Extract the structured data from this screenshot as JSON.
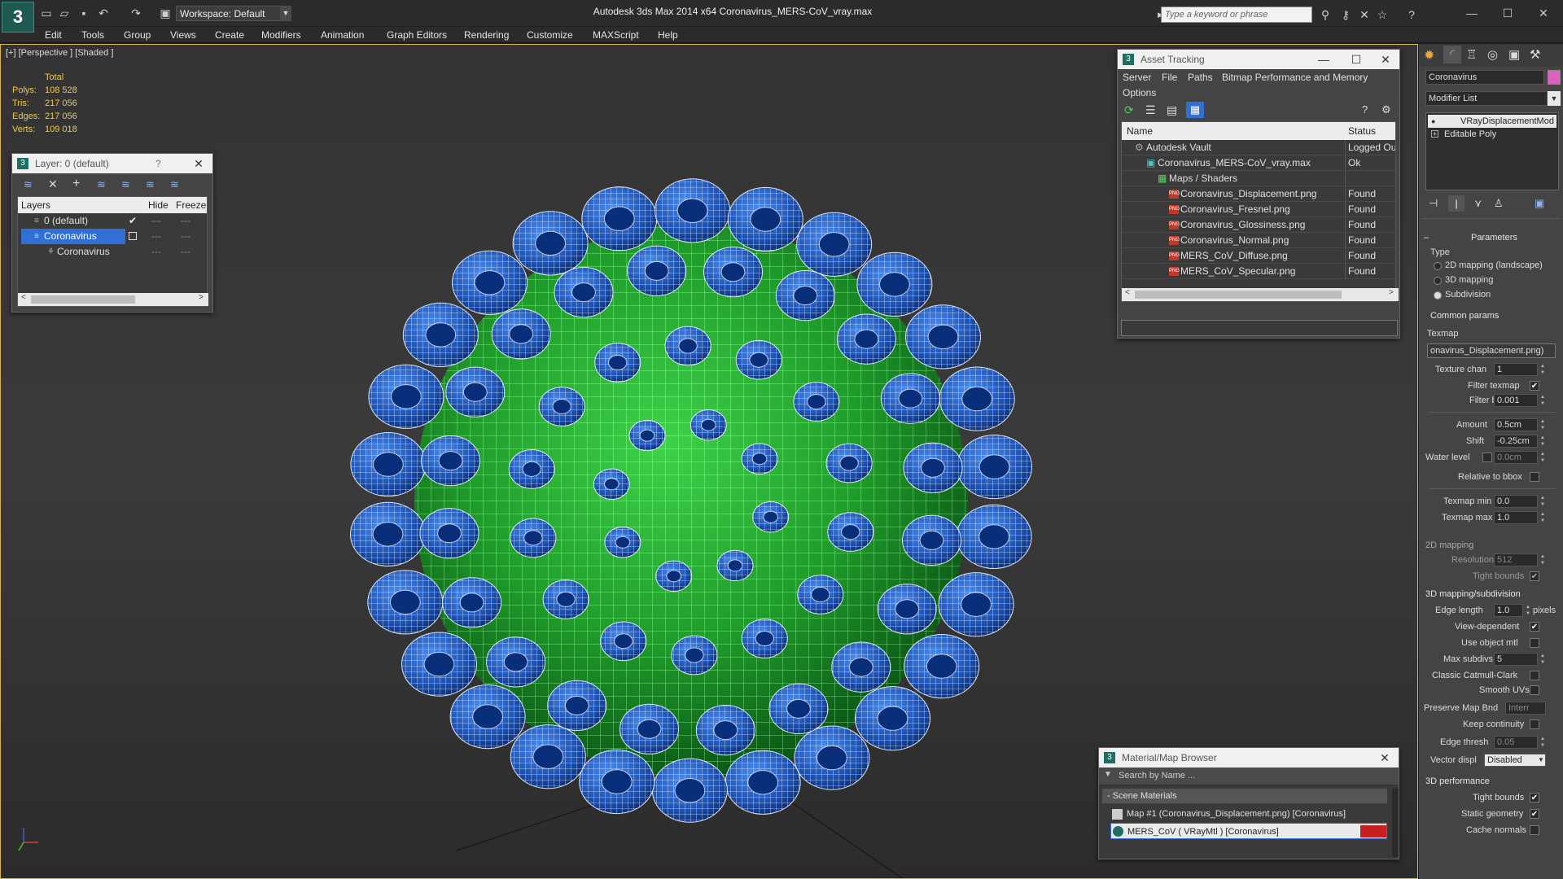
{
  "titlebar": {
    "workspace": "Workspace: Default",
    "title": "Autodesk 3ds Max  2014 x64      Coronavirus_MERS-CoV_vray.max",
    "search_placeholder": "Type a keyword or phrase"
  },
  "menu": [
    "Edit",
    "Tools",
    "Group",
    "Views",
    "Create",
    "Modifiers",
    "Animation",
    "Graph Editors",
    "Rendering",
    "Customize",
    "MAXScript",
    "Help"
  ],
  "viewport": {
    "label": "[+] [Perspective ] [Shaded ]",
    "stats_header": "Total",
    "stats": [
      {
        "key": "Polys:",
        "value": "108 528"
      },
      {
        "key": "Tris:",
        "value": "217 056"
      },
      {
        "key": "Edges:",
        "value": "217 056"
      },
      {
        "key": "Verts:",
        "value": "109 018"
      }
    ]
  },
  "layer_window": {
    "title": "Layer: 0 (default)",
    "help": "?",
    "columns": [
      "Layers",
      "Hide",
      "Freeze"
    ],
    "rows": [
      "0 (default)",
      "Coronavirus",
      "Coronavirus"
    ]
  },
  "asset_tracking": {
    "title": "Asset Tracking",
    "menu": [
      "Server",
      "File",
      "Paths",
      "Bitmap Performance and Memory",
      "Options"
    ],
    "columns": [
      "Name",
      "Status"
    ],
    "rows": [
      {
        "name": "Autodesk Vault",
        "status": "Logged Ou"
      },
      {
        "name": "Coronavirus_MERS-CoV_vray.max",
        "status": "Ok"
      },
      {
        "name": "Maps / Shaders",
        "status": ""
      },
      {
        "name": "Coronavirus_Displacement.png",
        "status": "Found"
      },
      {
        "name": "Coronavirus_Fresnel.png",
        "status": "Found"
      },
      {
        "name": "Coronavirus_Glossiness.png",
        "status": "Found"
      },
      {
        "name": "Coronavirus_Normal.png",
        "status": "Found"
      },
      {
        "name": "MERS_CoV_Diffuse.png",
        "status": "Found"
      },
      {
        "name": "MERS_CoV_Specular.png",
        "status": "Found"
      }
    ]
  },
  "material_browser": {
    "title": "Material/Map Browser",
    "search_placeholder": "Search by Name ...",
    "section": "- Scene Materials",
    "items": [
      "Map #1 (Coronavirus_Displacement.png) [Coronavirus]",
      "MERS_CoV  ( VRayMtl )  [Coronavirus]"
    ]
  },
  "command_panel": {
    "object_name": "Coronavirus",
    "modifier_list": "Modifier List",
    "stack": [
      "VRayDisplacementMod",
      "Editable Poly"
    ],
    "rollout": "Parameters",
    "type_label": "Type",
    "type_options": [
      "2D mapping (landscape)",
      "3D mapping",
      "Subdivision"
    ],
    "common_params": "Common params",
    "texmap_label": "Texmap",
    "texmap_value": "onavirus_Displacement.png)",
    "texture_chan_label": "Texture chan",
    "texture_chan": "1",
    "filter_texmap": "Filter texmap",
    "filter_blur_label": "Filter blur",
    "filter_blur": "0.001",
    "amount_label": "Amount",
    "amount": "0.5cm",
    "shift_label": "Shift",
    "shift": "-0.25cm",
    "water_level_label": "Water level",
    "water_level": "0.0cm",
    "relative_bbox": "Relative to bbox",
    "texmap_min_label": "Texmap min",
    "texmap_min": "0.0",
    "texmap_max_label": "Texmap max",
    "texmap_max": "1.0",
    "section_2d": "2D mapping",
    "resolution_label": "Resolution",
    "resolution": "512",
    "tight_bounds": "Tight bounds",
    "section_3d": "3D mapping/subdivision",
    "edge_length_label": "Edge length",
    "edge_length": "1.0",
    "pixels": "pixels",
    "view_dependent": "View-dependent",
    "use_object_mtl": "Use object mtl",
    "max_subdivs_label": "Max subdivs",
    "max_subdivs": "5",
    "classic_catmull": "Classic Catmull-Clark",
    "smooth_uvs": "Smooth UVs",
    "preserve_map_bnd": "Preserve Map Bnd",
    "preserve_value": "Interr",
    "keep_continuity": "Keep continuity",
    "edge_thresh_label": "Edge thresh",
    "edge_thresh": "0.05",
    "vector_displ_label": "Vector displ",
    "vector_displ": "Disabled",
    "section_perf": "3D performance",
    "perf_tight_bounds": "Tight bounds",
    "static_geometry": "Static geometry",
    "cache_normals": "Cache normals"
  }
}
